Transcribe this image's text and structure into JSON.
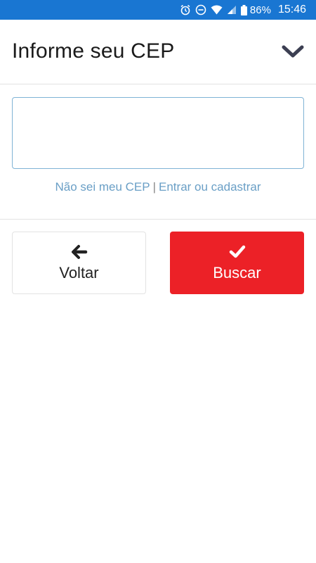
{
  "status_bar": {
    "battery_percent": "86%",
    "time": "15:46",
    "icons": [
      "alarm-icon",
      "do-not-disturb-icon",
      "wifi-icon",
      "cell-signal-icon",
      "battery-icon"
    ],
    "background_color": "#1976d2"
  },
  "header": {
    "title": "Informe seu CEP",
    "toggle_icon": "chevron-down-icon"
  },
  "cep_input": {
    "value": "",
    "placeholder": ""
  },
  "links": {
    "unknown_cep": "Não sei meu CEP",
    "separator": "|",
    "login_signup": "Entrar ou cadastrar"
  },
  "buttons": {
    "back": {
      "label": "Voltar",
      "icon": "arrow-left-icon"
    },
    "search": {
      "label": "Buscar",
      "icon": "checkmark-icon",
      "color": "#ec2127"
    }
  }
}
